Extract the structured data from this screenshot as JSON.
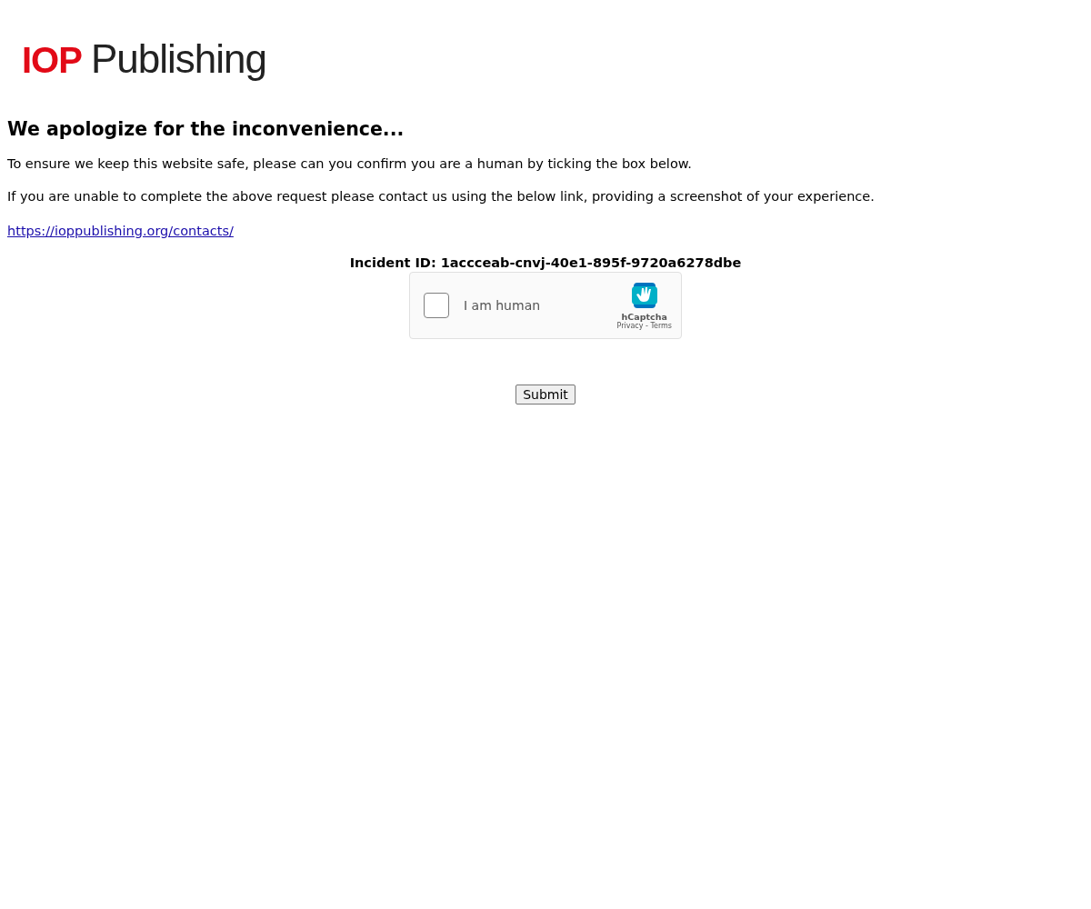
{
  "logo": {
    "mark": "IOP",
    "word": "Publishing"
  },
  "heading": "We apologize for the inconvenience...",
  "paragraphs": [
    "To ensure we keep this website safe, please can you confirm you are a human by ticking the box below.",
    "If you are unable to complete the above request please contact us using the below link, providing a screenshot of your experience."
  ],
  "contact_link": "https://ioppublishing.org/contacts/",
  "incident": "Incident ID: 1accceab-cnvj-40e1-895f-9720a6278dbe",
  "captcha": {
    "label": "I am human",
    "checked": false,
    "brand": "hCaptcha",
    "privacy": "Privacy",
    "separator": " - ",
    "terms": "Terms"
  },
  "submit": "Submit"
}
